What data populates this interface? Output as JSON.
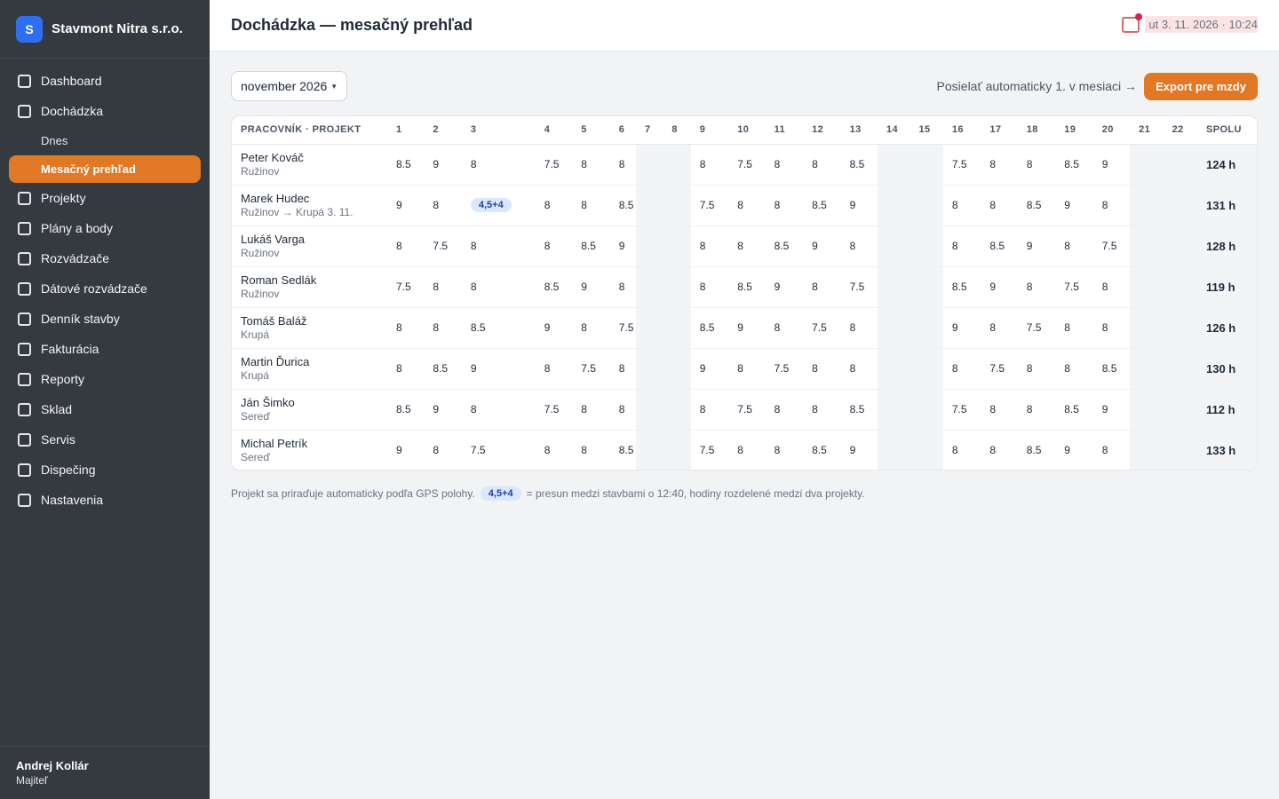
{
  "brand": {
    "logo_letter": "S",
    "name": "Stavmont Nitra s.r.o."
  },
  "nav": {
    "dashboard": "Dashboard",
    "dochadzka": "Dochádzka",
    "dnes": "Dnes",
    "mesacny": "Mesačný prehľad",
    "projekty": "Projekty",
    "plany": "Plány a body",
    "rozvadzace": "Rozvádzače",
    "datove": "Dátové rozvádzače",
    "dennik": "Denník stavby",
    "fakturacia": "Fakturácia",
    "reporty": "Reporty",
    "sklad": "Sklad",
    "servis": "Servis",
    "dispecing": "Dispečing",
    "nastavenia": "Nastavenia"
  },
  "user": {
    "name": "Andrej Kollár",
    "role": "Majiteľ"
  },
  "header": {
    "title": "Dochádzka — mesačný prehľad",
    "datetime": "ut 3. 11. 2026 · 10:24"
  },
  "toolbar": {
    "month": "november 2026",
    "auto_send": "Posielať automaticky 1. v mesiaci →",
    "export": "Export pre mzdy"
  },
  "table": {
    "h_worker": "PRACOVNÍK · PROJEKT",
    "h_total": "SPOLU",
    "day_headers": [
      "1",
      "2",
      "3",
      "4",
      "5",
      "6",
      "7",
      "8",
      "9",
      "10",
      "11",
      "12",
      "13",
      "14",
      "15",
      "16",
      "17",
      "18",
      "19",
      "20",
      "21",
      "22"
    ],
    "rows": [
      {
        "name": "Peter Kováč",
        "project": "Ružinov",
        "days": [
          "8.5",
          "9",
          "8",
          "7.5",
          "8",
          "8",
          "",
          "",
          "8",
          "7.5",
          "8",
          "8",
          "8.5",
          "",
          "",
          "7.5",
          "8",
          "8",
          "8.5",
          "9",
          "",
          ""
        ],
        "total": "124 h"
      },
      {
        "name": "Marek Hudec",
        "project": "Ružinov → Krupá 3. 11.",
        "days": [
          "9",
          "8",
          "4,5+4",
          "8",
          "8",
          "8.5",
          "",
          "",
          "7.5",
          "8",
          "8",
          "8.5",
          "9",
          "",
          "",
          "8",
          "8",
          "8.5",
          "9",
          "8",
          "",
          ""
        ],
        "total": "131 h"
      },
      {
        "name": "Lukáš Varga",
        "project": "Ružinov",
        "days": [
          "8",
          "7.5",
          "8",
          "8",
          "8.5",
          "9",
          "",
          "",
          "8",
          "8",
          "8.5",
          "9",
          "8",
          "",
          "",
          "8",
          "8.5",
          "9",
          "8",
          "7.5",
          "",
          ""
        ],
        "total": "128 h"
      },
      {
        "name": "Roman Sedlák",
        "project": "Ružinov",
        "days": [
          "7.5",
          "8",
          "8",
          "8.5",
          "9",
          "8",
          "",
          "",
          "8",
          "8.5",
          "9",
          "8",
          "7.5",
          "",
          "",
          "8.5",
          "9",
          "8",
          "7.5",
          "8",
          "",
          ""
        ],
        "total": "119 h"
      },
      {
        "name": "Tomáš Baláž",
        "project": "Krupá",
        "days": [
          "8",
          "8",
          "8.5",
          "9",
          "8",
          "7.5",
          "",
          "",
          "8.5",
          "9",
          "8",
          "7.5",
          "8",
          "",
          "",
          "9",
          "8",
          "7.5",
          "8",
          "8",
          "",
          ""
        ],
        "total": "126 h"
      },
      {
        "name": "Martin Ďurica",
        "project": "Krupá",
        "days": [
          "8",
          "8.5",
          "9",
          "8",
          "7.5",
          "8",
          "",
          "",
          "9",
          "8",
          "7.5",
          "8",
          "8",
          "",
          "",
          "8",
          "7.5",
          "8",
          "8",
          "8.5",
          "",
          ""
        ],
        "total": "130 h"
      },
      {
        "name": "Ján Šimko",
        "project": "Sereď",
        "days": [
          "8.5",
          "9",
          "8",
          "7.5",
          "8",
          "8",
          "",
          "",
          "8",
          "7.5",
          "8",
          "8",
          "8.5",
          "",
          "",
          "7.5",
          "8",
          "8",
          "8.5",
          "9",
          "",
          ""
        ],
        "total": "112 h"
      },
      {
        "name": "Michal Petrík",
        "project": "Sereď",
        "days": [
          "9",
          "8",
          "7.5",
          "8",
          "8",
          "8.5",
          "",
          "",
          "7.5",
          "8",
          "8",
          "8.5",
          "9",
          "",
          "",
          "8",
          "8",
          "8.5",
          "9",
          "8",
          "",
          ""
        ],
        "total": "133 h"
      }
    ]
  },
  "footnote": {
    "before": "Projekt sa priraďuje automaticky podľa GPS polohy.",
    "pill": "4,5+4",
    "after": "= presun medzi stavbami o 12:40, hodiny rozdelené medzi dva projekty."
  },
  "colors": {
    "accent": "#e07826",
    "sidebar": "#353a41",
    "brand_blue": "#2d6ff0",
    "pill_bg": "#dbe7fb",
    "pill_text": "#1e40af"
  },
  "icons": {
    "brand": "logo-square-icon",
    "nav": "checkbox-icon",
    "notification": "calendar-bell-icon"
  }
}
